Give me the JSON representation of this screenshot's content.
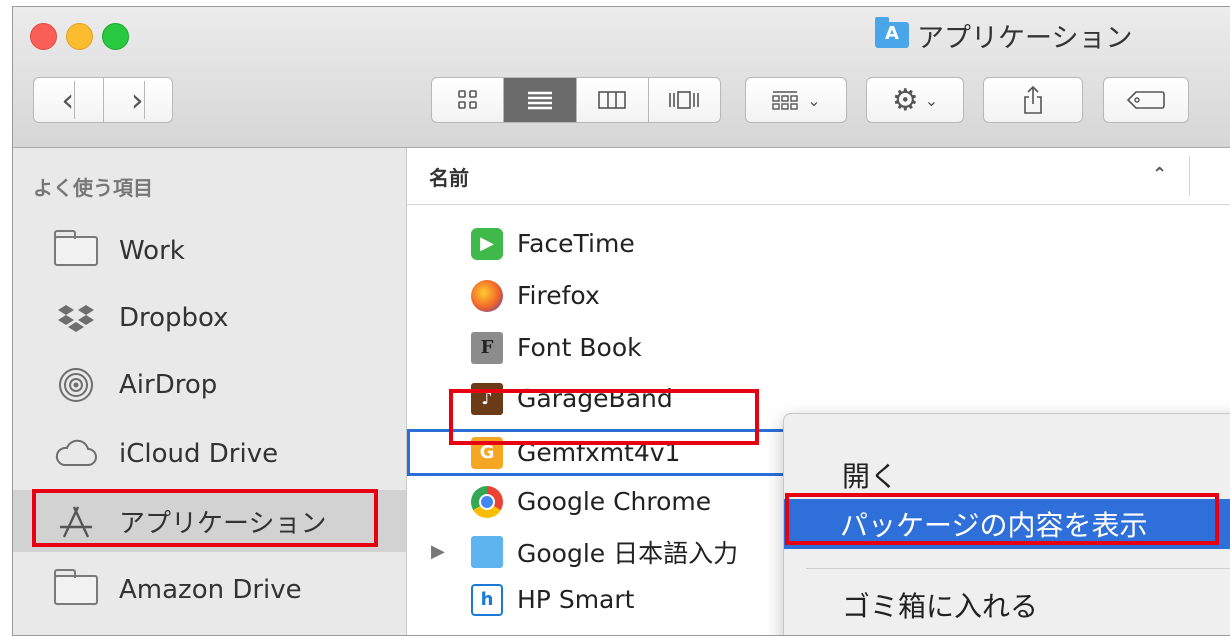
{
  "window": {
    "title": "アプリケーション"
  },
  "toolbar": {
    "back_icon": "chevron-left-icon",
    "forward_icon": "chevron-right-icon",
    "views": [
      "icon-view",
      "list-view",
      "column-view",
      "cover-flow-view"
    ],
    "selected_view": "list-view",
    "arrange_icon": "arrange-icon",
    "action_icon": "gear-icon",
    "share_icon": "share-icon",
    "tag_icon": "tag-icon"
  },
  "sidebar": {
    "header": "よく使う項目",
    "items": [
      {
        "label": "Work",
        "icon": "folder-icon"
      },
      {
        "label": "Dropbox",
        "icon": "dropbox-icon"
      },
      {
        "label": "AirDrop",
        "icon": "airdrop-icon"
      },
      {
        "label": "iCloud Drive",
        "icon": "cloud-icon"
      },
      {
        "label": "アプリケーション",
        "icon": "applications-icon",
        "selected": true
      },
      {
        "label": "Amazon Drive",
        "icon": "folder-icon"
      }
    ]
  },
  "list": {
    "column_name": "名前",
    "rows": [
      {
        "label": "FaceTime",
        "icon": "facetime-icon"
      },
      {
        "label": "Firefox",
        "icon": "firefox-icon"
      },
      {
        "label": "Font Book",
        "icon": "fontbook-icon"
      },
      {
        "label": "GarageBand",
        "icon": "garageband-icon"
      },
      {
        "label": "Gemfxmt4v1",
        "icon": "gemfxmt-icon",
        "selected": true
      },
      {
        "label": "Google Chrome",
        "icon": "chrome-icon"
      },
      {
        "label": "Google 日本語入力",
        "icon": "folder-icon",
        "expandable": true
      },
      {
        "label": "HP Smart",
        "icon": "hpsmart-icon"
      }
    ]
  },
  "context_menu": {
    "items": [
      {
        "label": "開く"
      },
      {
        "label": "パッケージの内容を表示",
        "highlighted": true
      },
      {
        "label": "ゴミ箱に入れる"
      }
    ]
  },
  "colors": {
    "highlight": "#2f6fd9",
    "annotation": "#e60012"
  }
}
